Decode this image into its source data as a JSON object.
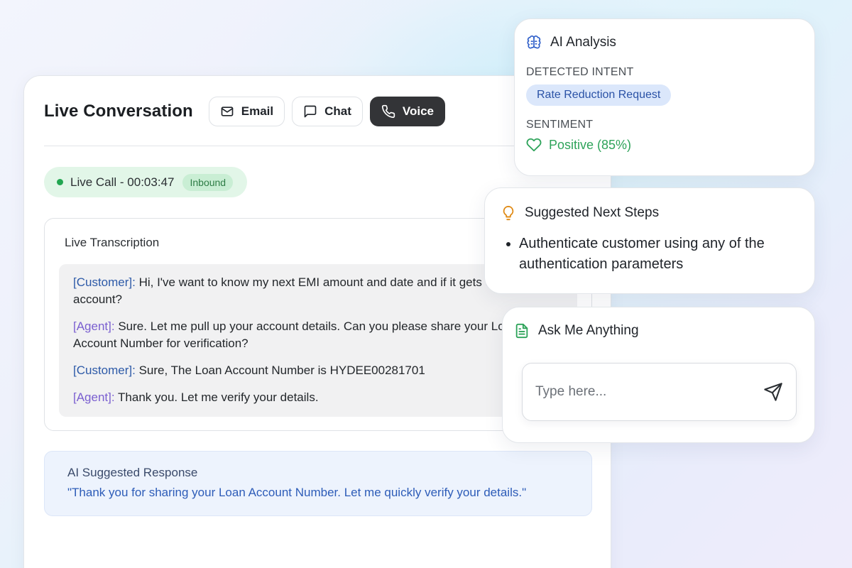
{
  "main": {
    "title": "Live Conversation",
    "tabs": [
      {
        "label": "Email",
        "icon": "mail-icon",
        "active": false
      },
      {
        "label": "Chat",
        "icon": "chat-icon",
        "active": false
      },
      {
        "label": "Voice",
        "icon": "phone-icon",
        "active": true
      }
    ],
    "call_status": {
      "text": "Live Call - 00:03:47",
      "badge": "Inbound"
    },
    "transcription": {
      "title": "Live Transcription",
      "lines": [
        {
          "speaker": "[Customer]:",
          "text": " Hi, I've want to know my next EMI amount and date and if it gets debit from my account?"
        },
        {
          "speaker": "[Agent]:",
          "text": " Sure. Let me pull up your account details. Can you please share your Loan Account Number for verification?"
        },
        {
          "speaker": "[Customer]:",
          "text": " Sure, The Loan Account Number is HYDEE00281701"
        },
        {
          "speaker": "[Agent]:",
          "text": " Thank you. Let me verify your details."
        }
      ]
    },
    "suggested_response": {
      "title": "AI Suggested Response",
      "text": "\"Thank you for sharing your Loan Account Number. Let me quickly verify your details.\""
    }
  },
  "analysis": {
    "title": "AI Analysis",
    "intent_label": "DETECTED INTENT",
    "intent_value": "Rate Reduction Request",
    "sentiment_label": "SENTIMENT",
    "sentiment_value": "Positive (85%)"
  },
  "next_steps": {
    "title": "Suggested Next Steps",
    "items": [
      "Authenticate customer using any of the authentication parameters"
    ]
  },
  "ask": {
    "title": "Ask Me Anything",
    "placeholder": "Type here..."
  },
  "colors": {
    "accent_dark": "#333437",
    "live_green": "#22a651",
    "customer_blue": "#2d5aa8",
    "agent_purple": "#7a5fd0",
    "intent_blue": "#2a52a6",
    "positive_green": "#2ea35a",
    "bulb_orange": "#e08a14"
  }
}
